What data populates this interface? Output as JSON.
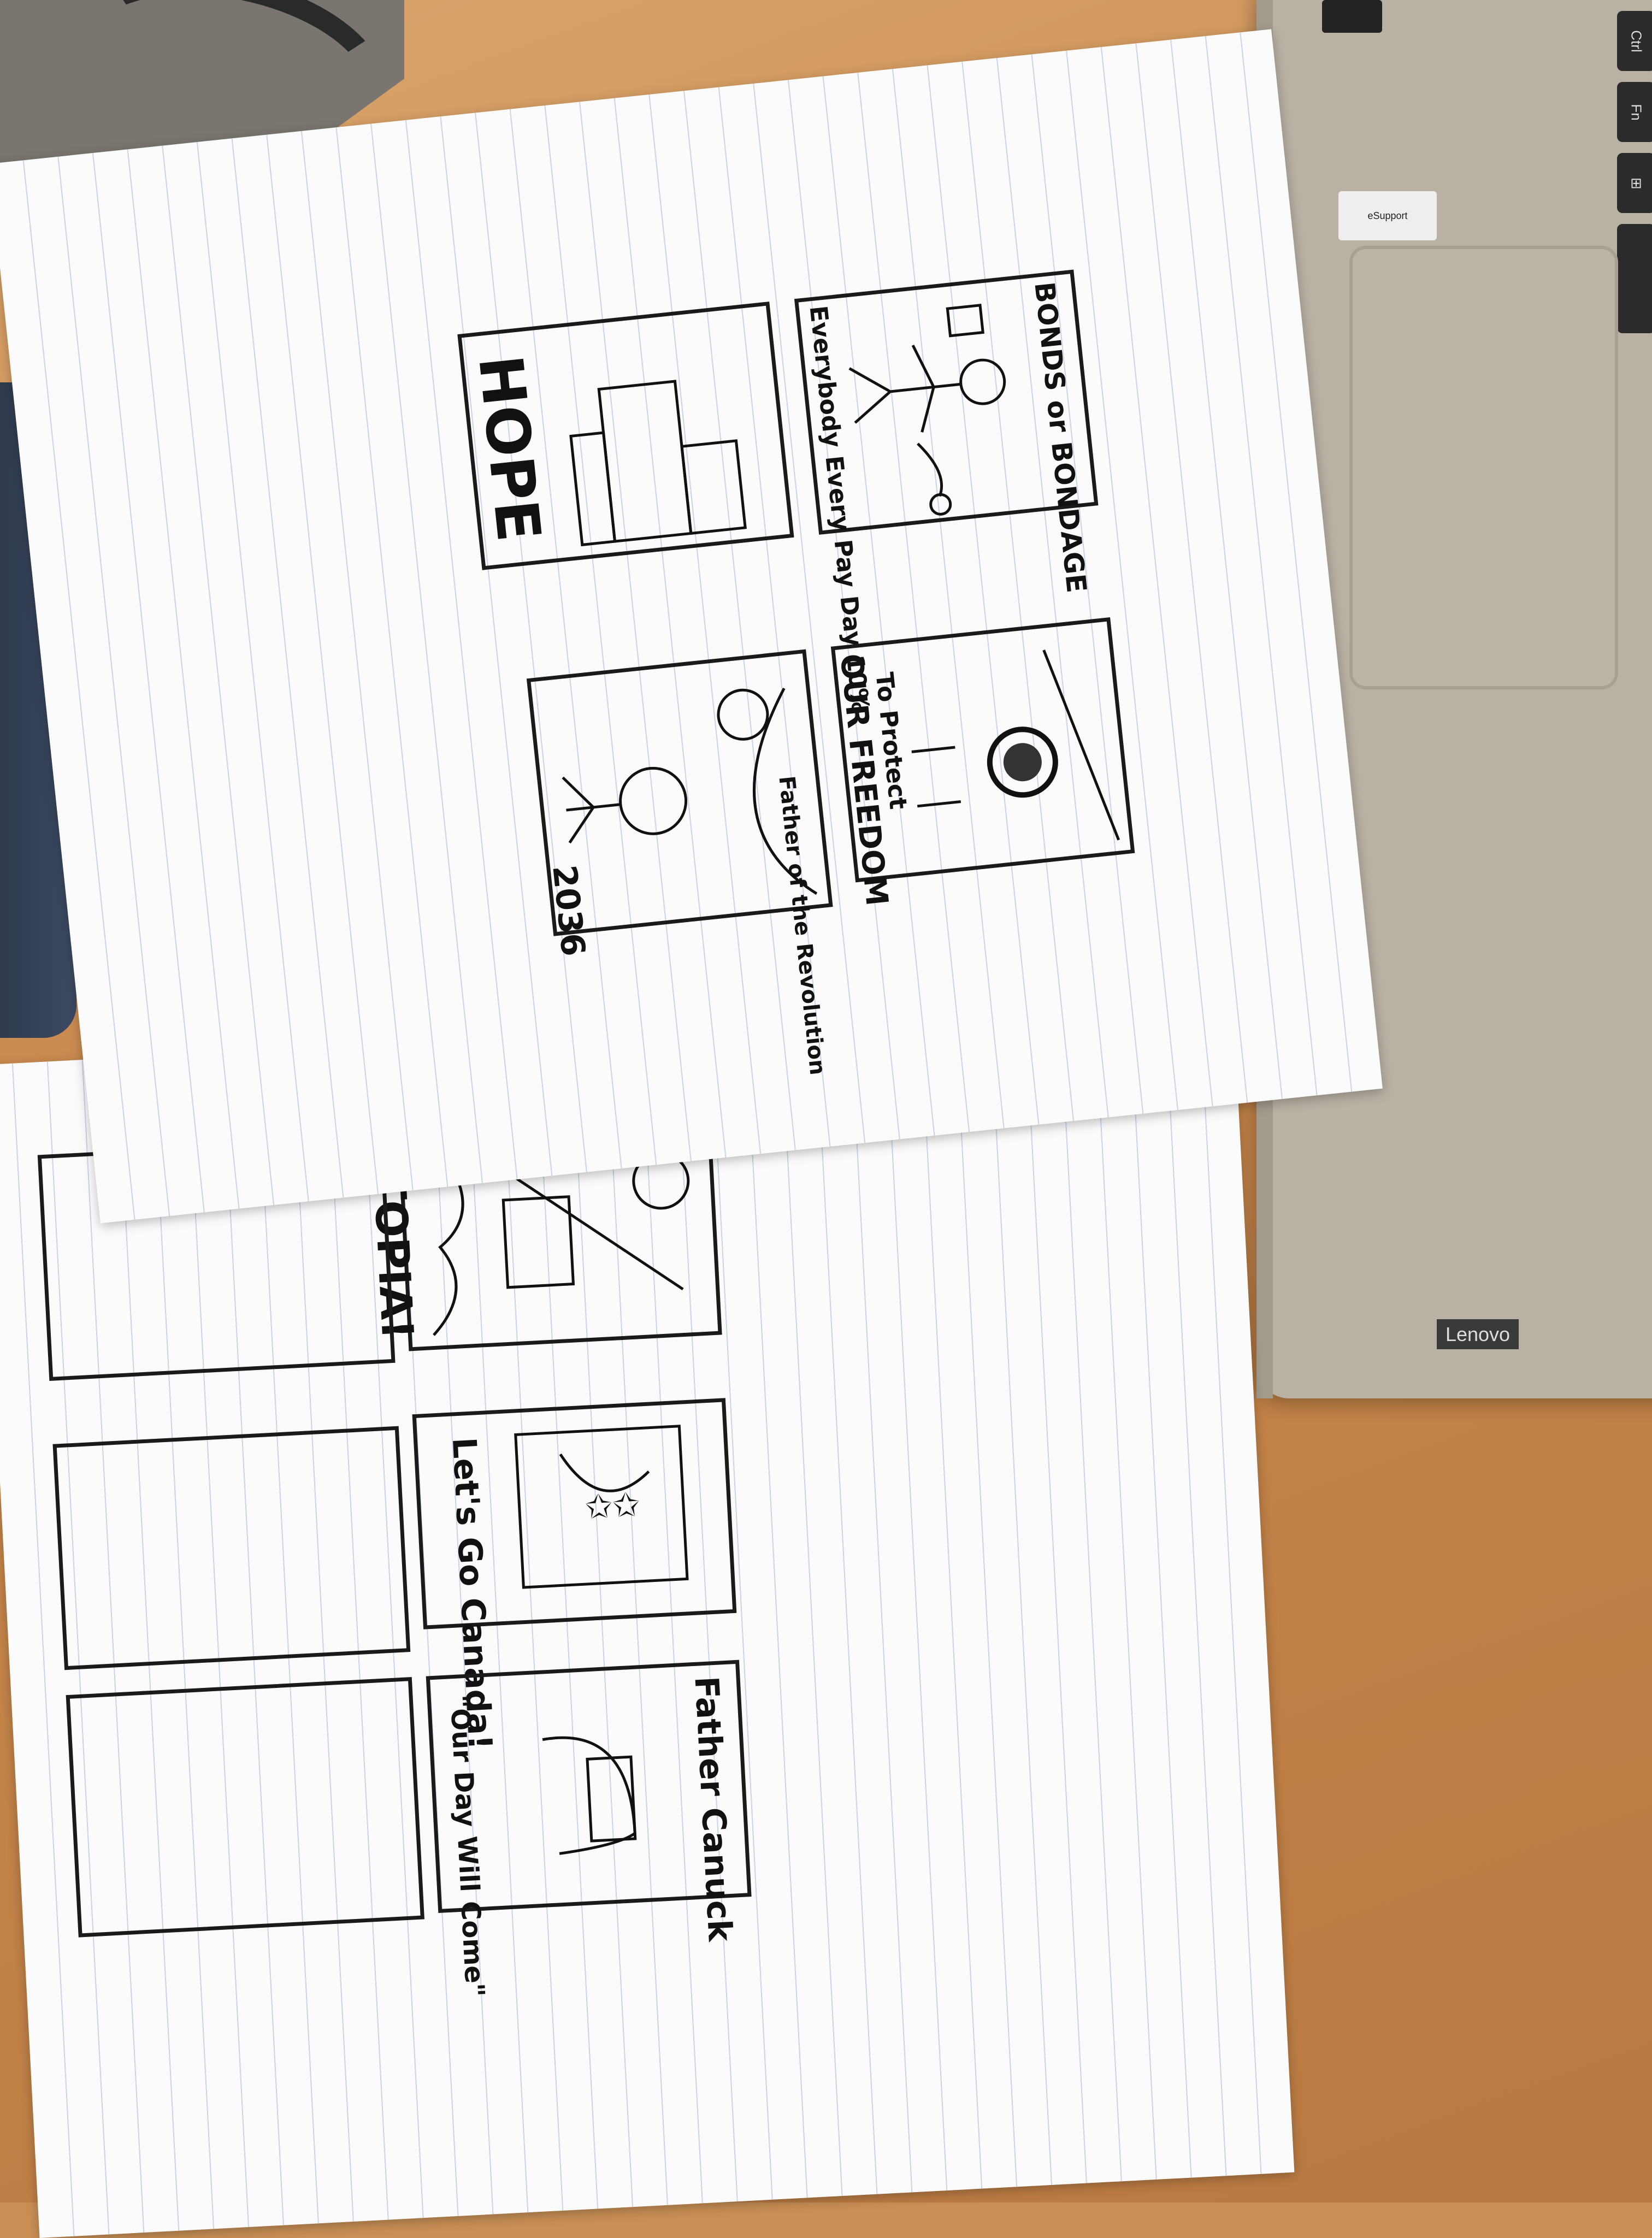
{
  "scene": {
    "laptop": {
      "brand_label": "Lenovo",
      "keys": [
        "Ctrl",
        "Fn"
      ],
      "sticker_support": "eSupport"
    }
  },
  "sheet_one": {
    "panels": [
      {
        "text": "BONDS or BONDAGE"
      },
      {
        "text": "Everybody Every Pay Day 10%"
      },
      {
        "text": "HOPE"
      },
      {
        "text": "OUR FREEDOM"
      },
      {
        "text": "To Protect"
      },
      {
        "text": "Father of the Revolution"
      },
      {
        "text": "2036"
      }
    ]
  },
  "sheet_two": {
    "panels": [
      {
        "text": "UTOPIA!"
      },
      {
        "text": "Let's Go Canada!"
      },
      {
        "text": "Father Canuck"
      },
      {
        "text": "\"Our Day Will Come\""
      }
    ]
  },
  "colors": {
    "desk": "#c98f55",
    "paper": "#fbfbfb",
    "ink": "#111111",
    "laptop": "#b9b1a4"
  }
}
